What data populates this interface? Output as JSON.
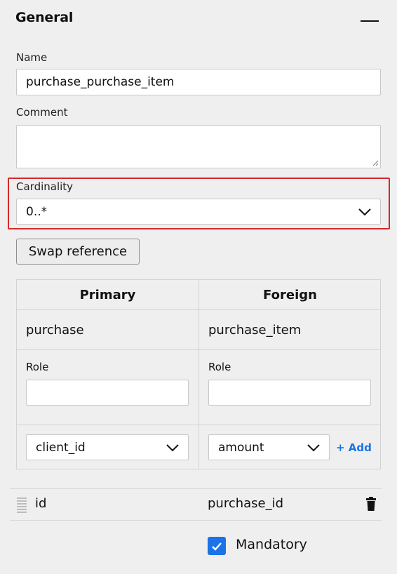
{
  "section": {
    "title": "General",
    "collapse_icon": "minus-icon"
  },
  "name": {
    "label": "Name",
    "value": "purchase_purchase_item"
  },
  "comment": {
    "label": "Comment",
    "value": ""
  },
  "cardinality": {
    "label": "Cardinality",
    "selected": "0..*",
    "highlight_color": "#d42a2a"
  },
  "swap_button": {
    "label": "Swap reference"
  },
  "table": {
    "headers": {
      "primary": "Primary",
      "foreign": "Foreign"
    },
    "primary": {
      "entity": "purchase",
      "role_label": "Role",
      "role_value": "",
      "column_selected": "client_id"
    },
    "foreign": {
      "entity": "purchase_item",
      "role_label": "Role",
      "role_value": "",
      "column_selected": "amount",
      "add_label": "+ Add"
    }
  },
  "mapping": {
    "primary_column": "id",
    "foreign_column": "purchase_id"
  },
  "mandatory": {
    "label": "Mandatory",
    "checked": true
  },
  "colors": {
    "accent": "#1a73e8",
    "background": "#efefef"
  }
}
